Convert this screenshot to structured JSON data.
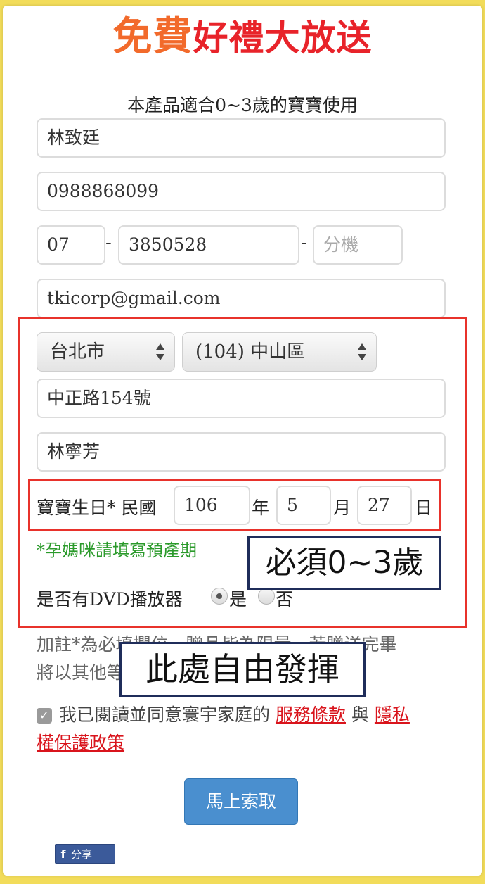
{
  "header": {
    "title_part1": "免費",
    "title_part2": "好禮大放送",
    "subtitle": "本產品適合0~3歲的寶寶使用"
  },
  "form": {
    "name": "林致廷",
    "mobile": "0988868099",
    "phone_area": "07",
    "phone_number": "3850528",
    "phone_ext_placeholder": "分機",
    "email": "tkicorp@gmail.com",
    "city": "台北市",
    "district": "(104) 中山區",
    "address": "中正路154號",
    "recipient": "林寧芳",
    "birthday": {
      "label": "寶寶生日* 民國",
      "year": "106",
      "year_unit": "年",
      "month": "5",
      "month_unit": "月",
      "day": "27",
      "day_unit": "日"
    },
    "pregnancy_note": "*孕媽咪請填寫預產期",
    "dvd": {
      "label": "是否有DVD播放器",
      "yes": "是",
      "no": "否",
      "selected": "是"
    },
    "separator": "-"
  },
  "annotations": {
    "age_callout": "必須0~3歲",
    "free_callout": "此處自由發揮"
  },
  "notes": {
    "line1_visible": "加註*為必填欄位，贈品皆為限量，若贈送完畢",
    "line2_visible": "將以其他等"
  },
  "agreement": {
    "text_before": "我已閱讀並同意寰宇家庭的",
    "terms_link": "服務條款",
    "conjunction": "與",
    "privacy_link_part1": "隱私",
    "privacy_link_part2": "權保護政策",
    "checked": true
  },
  "submit_label": "馬上索取",
  "share_label": "分享",
  "share_icon": "f"
}
